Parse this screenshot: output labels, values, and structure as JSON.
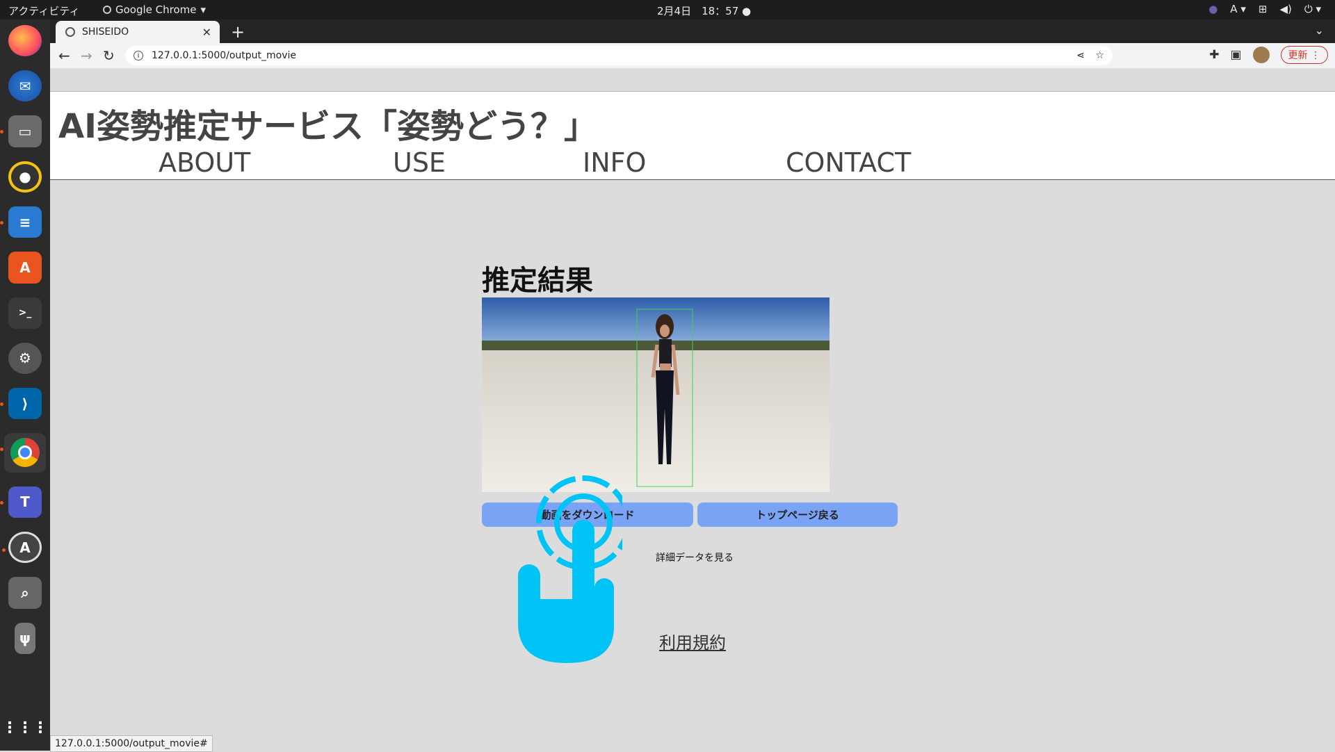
{
  "system": {
    "activities": "アクティビティ",
    "app_menu": "Google Chrome",
    "clock": "2月4日　18：57",
    "input_method": "A"
  },
  "dock": {
    "items": [
      {
        "name": "firefox-icon"
      },
      {
        "name": "thunderbird-icon"
      },
      {
        "name": "files-icon"
      },
      {
        "name": "rhythmbox-icon"
      },
      {
        "name": "writer-icon"
      },
      {
        "name": "software-icon"
      },
      {
        "name": "terminal-icon"
      },
      {
        "name": "settings-icon"
      },
      {
        "name": "vscode-icon"
      },
      {
        "name": "chrome-icon"
      },
      {
        "name": "teams-icon"
      },
      {
        "name": "updater-icon"
      },
      {
        "name": "search-icon"
      },
      {
        "name": "usb-icon"
      },
      {
        "name": "app-grid-icon"
      }
    ]
  },
  "browser": {
    "tab_title": "SHISEIDO",
    "url": "127.0.0.1:5000/output_movie",
    "update_label": "更新",
    "status_url": "127.0.0.1:5000/output_movie#"
  },
  "site": {
    "title": "AI姿勢推定サービス「姿勢どう？」",
    "nav": [
      "ABOUT",
      "USE",
      "INFO",
      "CONTACT"
    ]
  },
  "main": {
    "result_heading": "推定結果",
    "download_button": "動画をダウンロード",
    "top_button": "トップページ戻る",
    "detail_link": "詳細データを見る",
    "terms_link": "利用規約"
  },
  "colors": {
    "button": "#7aa3f5",
    "cursor_overlay": "#00c4f5",
    "page_bg": "#dcdcdc"
  }
}
